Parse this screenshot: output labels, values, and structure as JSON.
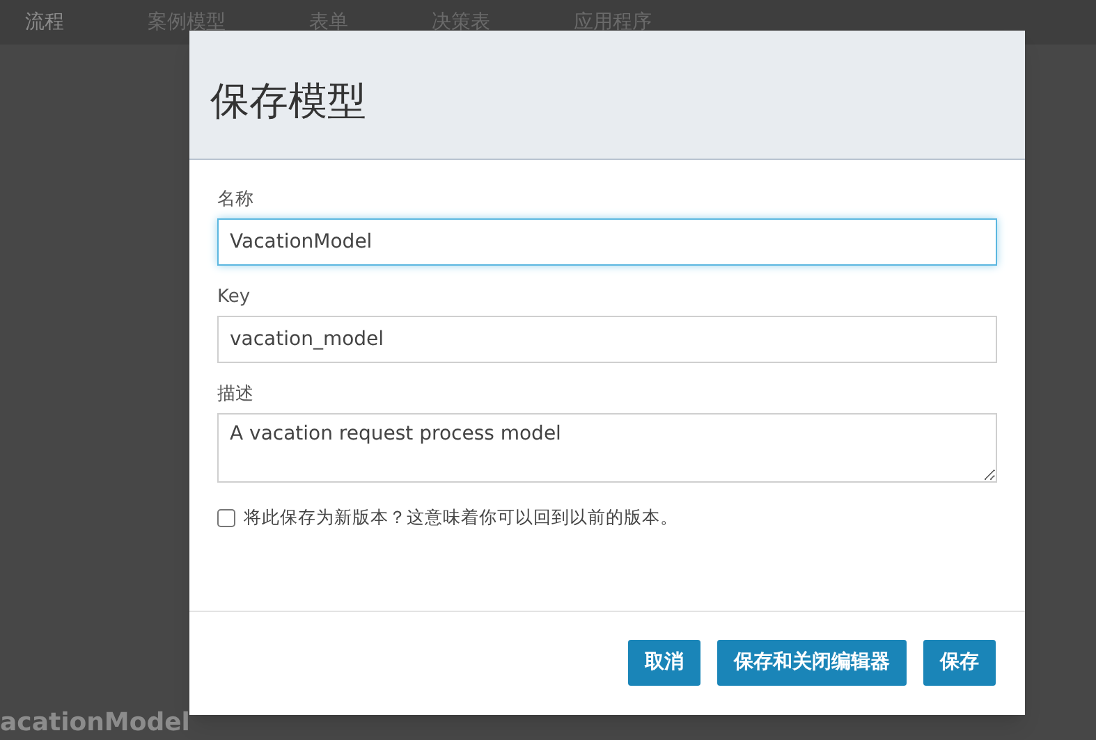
{
  "nav": {
    "items": [
      {
        "label": "流程",
        "selected": true
      },
      {
        "label": "案例模型",
        "selected": false
      },
      {
        "label": "表单",
        "selected": false
      },
      {
        "label": "决策表",
        "selected": false
      },
      {
        "label": "应用程序",
        "selected": false
      }
    ]
  },
  "background": {
    "title": "acationModel"
  },
  "dialog": {
    "title": "保存模型",
    "fields": [
      {
        "kind": "input",
        "label": "名称",
        "value": "VacationModel",
        "focused": true
      },
      {
        "kind": "input",
        "label": "Key",
        "value": "vacation_model",
        "focused": false
      },
      {
        "kind": "textarea",
        "label": "描述",
        "value": "A vacation request process model",
        "focused": false
      }
    ],
    "new_version": {
      "label": "将此保存为新版本？这意味着你可以回到以前的版本。",
      "checked": false
    },
    "buttons": [
      "取消",
      "保存和关闭编辑器",
      "保存"
    ]
  }
}
